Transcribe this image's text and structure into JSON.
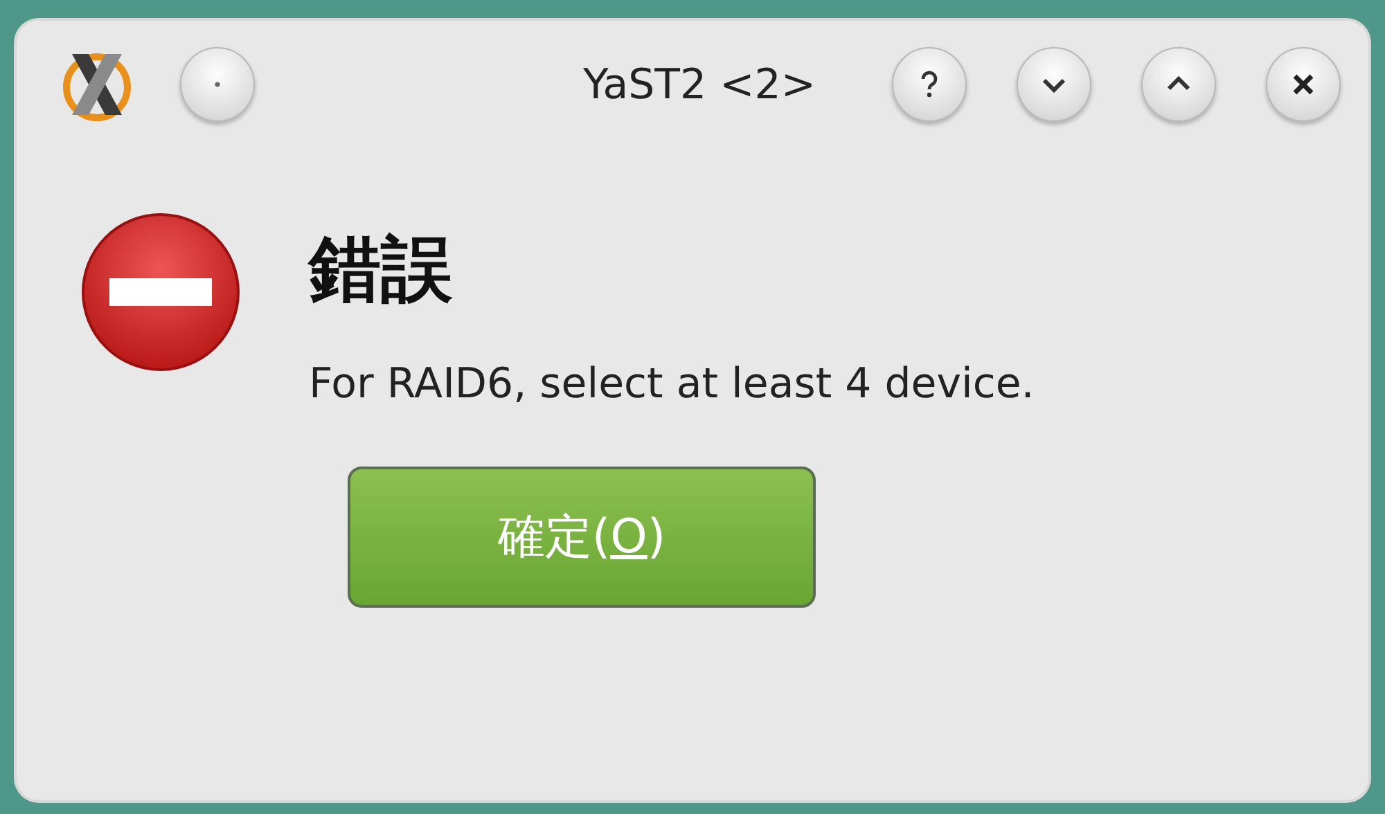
{
  "window": {
    "title": "YaST2 <2>"
  },
  "dialog": {
    "heading": "錯誤",
    "message": "For RAID6, select at least 4 device."
  },
  "button": {
    "label_before": "確定(",
    "mnemonic": "O",
    "label_after": ")"
  }
}
